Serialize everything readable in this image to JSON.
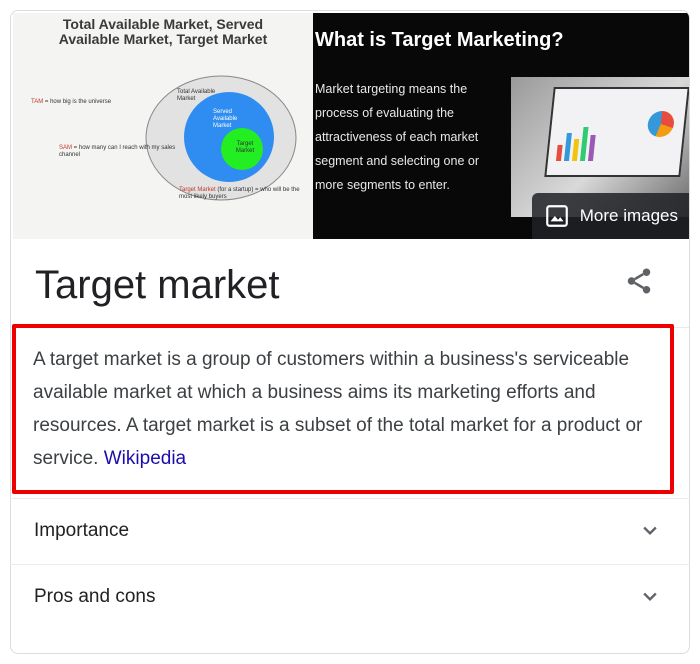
{
  "images": {
    "left": {
      "title_line1": "Total Available Market, Served",
      "title_line2": "Available Market, Target Market",
      "tam_label": "TAM",
      "tam_text": " = how big is the universe",
      "sam_label": "SAM",
      "sam_text": " = how many can I reach with my sales channel",
      "target_label": "Target Market",
      "target_text": " (for a startup) = who will be the most likely buyers",
      "circle_total": "Total Available Market",
      "circle_served": "Served Available Market",
      "circle_target": "Target Market",
      "colors": {
        "outer": "#e2e2e2",
        "served": "#2f8cf0",
        "target": "#22ee22"
      }
    },
    "right": {
      "title": "What is Target Marketing?",
      "body": "Market targeting means the process of evaluating the attractiveness of each market segment and selecting one or more segments to enter."
    },
    "more_images_label": "More images"
  },
  "header": {
    "title": "Target market"
  },
  "description": {
    "text": "A target market is a group of customers within a business's serviceable available market at which a business aims its marketing efforts and resources. A target market is a subset of the total market for a product or service.",
    "source_link": "Wikipedia"
  },
  "accordion": [
    {
      "label": "Importance"
    },
    {
      "label": "Pros and cons"
    }
  ],
  "colors": {
    "highlight_border": "#ee0000",
    "link": "#1a0dab",
    "text": "#202124"
  },
  "icons": {
    "share": "share-icon",
    "expand": "chevron-down-icon",
    "images": "image-icon"
  }
}
